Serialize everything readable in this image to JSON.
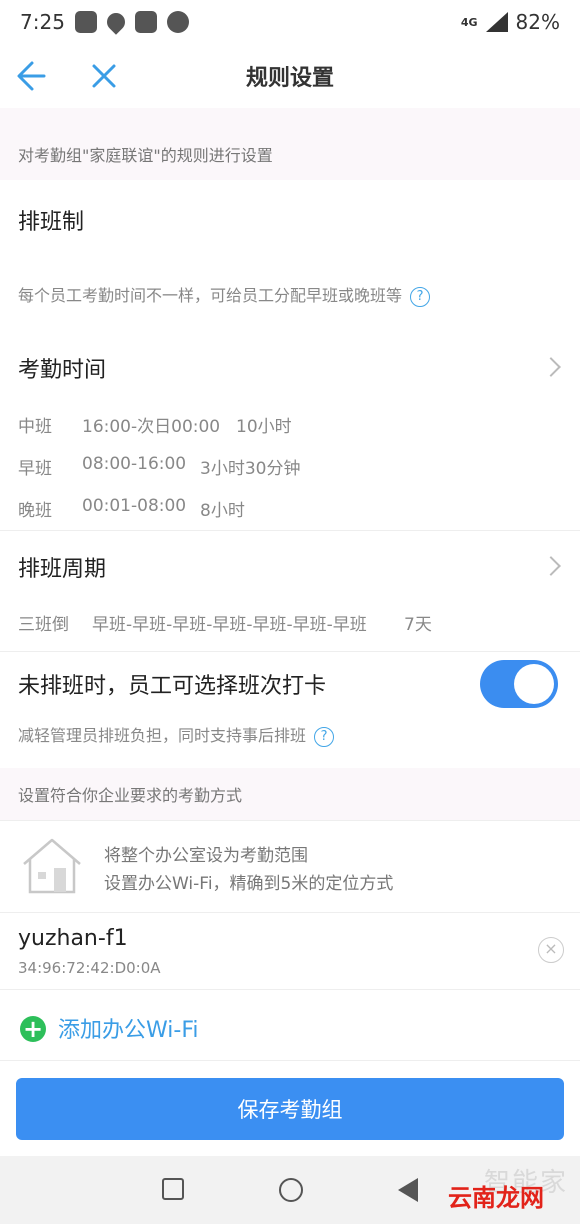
{
  "status": {
    "time": "7:25",
    "network": "4G",
    "battery": "82%",
    "icons": [
      "baidu-icon",
      "map-pin-icon",
      "image-icon",
      "wechat-icon"
    ]
  },
  "nav": {
    "title": "规则设置",
    "back_icon": "arrow-left-icon",
    "close_icon": "close-icon"
  },
  "intro": "对考勤组\"家庭联谊\"的规则进行设置",
  "schedule": {
    "title": "排班制",
    "desc": "每个员工考勤时间不一样，可给员工分配早班或晚班等",
    "help": "?"
  },
  "attendance_time": {
    "title": "考勤时间",
    "shifts": [
      {
        "name": "中班",
        "time": "16:00-次日00:00",
        "duration": "10小时"
      },
      {
        "name": "早班",
        "time": "08:00-16:00",
        "duration": "3小时30分钟"
      },
      {
        "name": "晚班",
        "time": "00:01-08:00",
        "duration": "8小时"
      }
    ]
  },
  "cycle": {
    "title": "排班周期",
    "name": "三班倒",
    "pattern": "早班-早班-早班-早班-早班-早班-早班",
    "days": "7天"
  },
  "free_choice": {
    "title": "未排班时，员工可选择班次打卡",
    "desc": "减轻管理员排班负担，同时支持事后排班",
    "help": "?",
    "enabled": true
  },
  "method_header": "设置符合你企业要求的考勤方式",
  "office": {
    "line1": "将整个办公室设为考勤范围",
    "line2": "设置办公Wi-Fi，精确到5米的定位方式"
  },
  "wifi": {
    "ssid": "yuzhan-f1",
    "mac": "34:96:72:42:D0:0A",
    "remove": "×"
  },
  "add_wifi": {
    "icon": "+",
    "label": "添加办公Wi-Fi"
  },
  "save_label": "保存考勤组",
  "watermark": {
    "line1": "智能家",
    "line2": "云南龙网"
  },
  "colors": {
    "accent": "#3b8ff2",
    "green": "#2dbf5a",
    "link": "#3a9de6"
  }
}
